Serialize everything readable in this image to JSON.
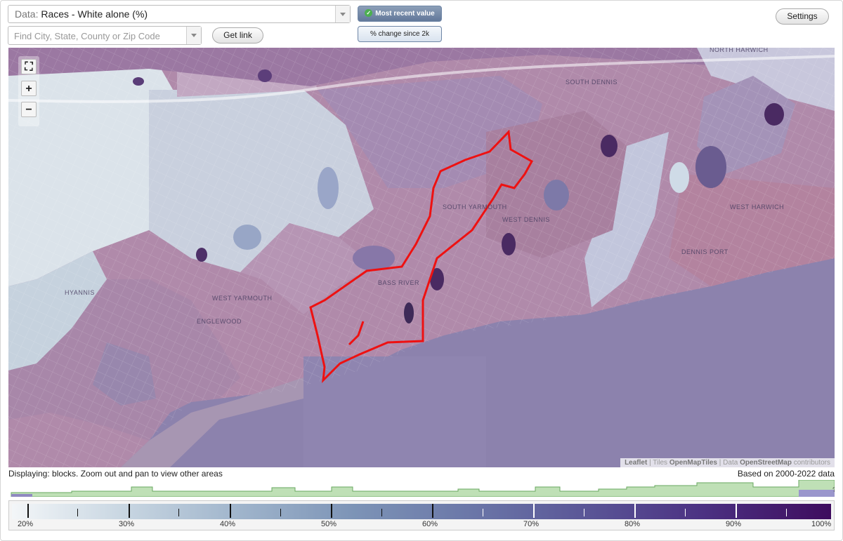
{
  "header": {
    "data_prefix": "Data:",
    "data_value": "Races - White alone (%)",
    "find_placeholder": "Find City, State, County or Zip Code",
    "get_link": "Get link",
    "most_recent": "Most recent value",
    "pct_change": "% change since 2k",
    "settings": "Settings"
  },
  "map": {
    "zoom_in": "+",
    "zoom_out": "−",
    "places": {
      "north_harwich": "NORTH HARWICH",
      "south_dennis": "SOUTH DENNIS",
      "south_yarmouth": "SOUTH YARMOUTH",
      "west_dennis": "WEST DENNIS",
      "west_harwich": "WEST HARWICH",
      "dennis_port": "DENNIS PORT",
      "bass_river": "BASS RIVER",
      "west_yarmouth": "WEST YARMOUTH",
      "hyannis": "HYANNIS",
      "englewood": "ENGLEWOOD"
    },
    "attribution": {
      "leaflet": "Leaflet",
      "tiles": "Tiles",
      "openmaptiles": "OpenMapTiles",
      "data": "Data",
      "osm": "OpenStreetMap",
      "contributors": "contributors"
    },
    "boundary_color": "#ee1111"
  },
  "footer": {
    "displaying": "Displaying: blocks. Zoom out and pan to view other areas",
    "based_on": "Based on 2000-2022 data",
    "histogram_question": "?"
  },
  "legend": {
    "labels": [
      "20%",
      "30%",
      "40%",
      "50%",
      "60%",
      "70%",
      "80%",
      "90%",
      "100%"
    ],
    "colors": [
      "#f3f6f8",
      "#c7d5e1",
      "#9fb4cb",
      "#7c93b6",
      "#6b77a8",
      "#5a5697",
      "#4c3283",
      "#3e0c5e"
    ]
  }
}
